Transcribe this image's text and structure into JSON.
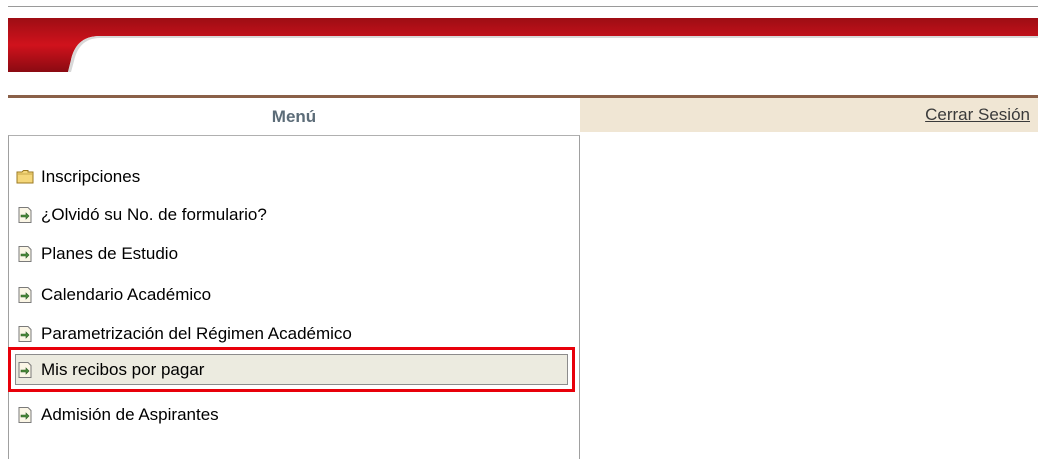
{
  "header": {
    "menu_title": "Menú",
    "logout_label": "Cerrar Sesión"
  },
  "menu": {
    "items": [
      {
        "label": "Inscripciones",
        "icon": "folder-icon"
      },
      {
        "label": "¿Olvidó su No. de formulario?",
        "icon": "page-link-icon"
      },
      {
        "label": "Planes de Estudio",
        "icon": "page-link-icon"
      },
      {
        "label": "Calendario Académico",
        "icon": "page-link-icon"
      },
      {
        "label": "Parametrización del Régimen Académico",
        "icon": "page-link-icon"
      },
      {
        "label": "Mis recibos por pagar",
        "icon": "page-link-icon",
        "highlighted": true
      },
      {
        "label": "Admisión de Aspirantes",
        "icon": "page-link-icon"
      }
    ]
  },
  "colors": {
    "banner_red": "#c8102e",
    "highlight_red": "#e8000a",
    "logout_bar_bg": "#f0e6d4",
    "menu_title_color": "#5c6c78"
  }
}
